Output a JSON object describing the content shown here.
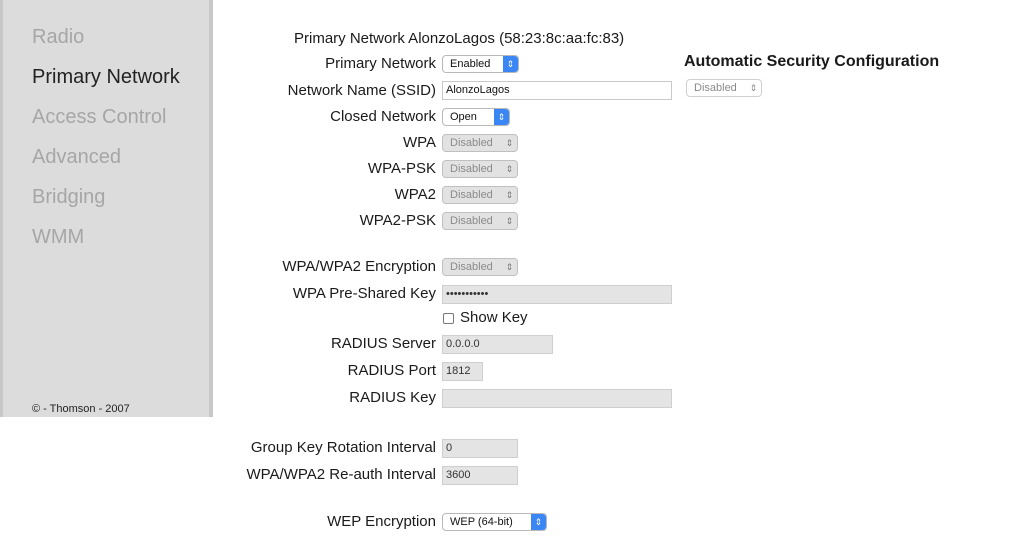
{
  "sidebar": {
    "items": [
      {
        "label": "Radio",
        "active": false
      },
      {
        "label": "Primary Network",
        "active": true
      },
      {
        "label": "Access Control",
        "active": false
      },
      {
        "label": "Advanced",
        "active": false
      },
      {
        "label": "Bridging",
        "active": false
      },
      {
        "label": "WMM",
        "active": false
      }
    ],
    "copyright": "© - Thomson - 2007"
  },
  "main": {
    "title": "Primary Network AlonzoLagos (58:23:8c:aa:fc:83)",
    "auto_security_title": "Automatic Security Configuration",
    "auto_security_value": "Disabled",
    "fields": {
      "primary_network": {
        "label": "Primary Network",
        "value": "Enabled"
      },
      "ssid": {
        "label": "Network Name (SSID)",
        "value": "AlonzoLagos"
      },
      "closed_network": {
        "label": "Closed Network",
        "value": "Open"
      },
      "wpa": {
        "label": "WPA",
        "value": "Disabled"
      },
      "wpa_psk": {
        "label": "WPA-PSK",
        "value": "Disabled"
      },
      "wpa2": {
        "label": "WPA2",
        "value": "Disabled"
      },
      "wpa2_psk": {
        "label": "WPA2-PSK",
        "value": "Disabled"
      },
      "encryption": {
        "label": "WPA/WPA2 Encryption",
        "value": "Disabled"
      },
      "psk": {
        "label": "WPA Pre-Shared Key",
        "value": "•••••••••••"
      },
      "show_key": {
        "label": "Show Key",
        "checked": false
      },
      "radius_server": {
        "label": "RADIUS Server",
        "value": "0.0.0.0"
      },
      "radius_port": {
        "label": "RADIUS Port",
        "value": "1812"
      },
      "radius_key": {
        "label": "RADIUS Key",
        "value": ""
      },
      "group_key_interval": {
        "label": "Group Key Rotation Interval",
        "value": "0"
      },
      "reauth_interval": {
        "label": "WPA/WPA2 Re-auth Interval",
        "value": "3600"
      },
      "wep_encryption": {
        "label": "WEP Encryption",
        "value": "WEP (64-bit)"
      }
    }
  },
  "colors": {
    "sidebar_bg": "#dcdcdc",
    "nav_inactive": "#a6a6a6",
    "nav_active": "#222222",
    "select_accent": "#3b86f5"
  },
  "icons": {
    "select_arrow": "updown-chevron-icon"
  }
}
